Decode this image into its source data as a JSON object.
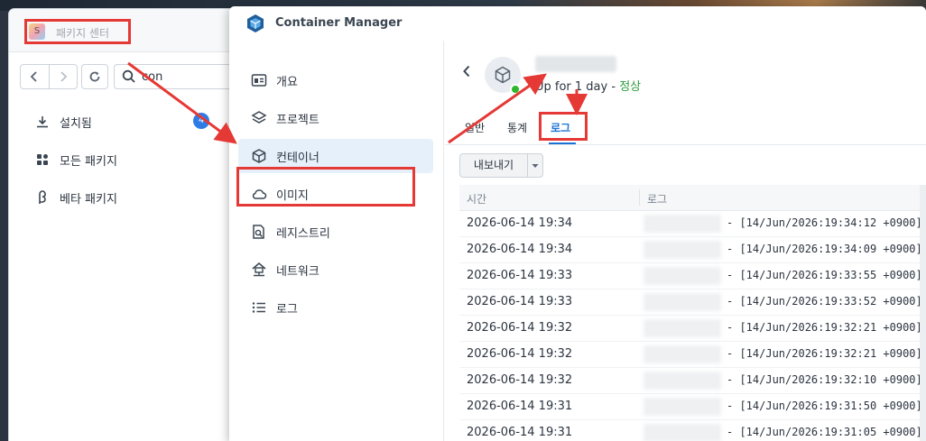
{
  "package_center": {
    "title": "패키지 센터",
    "search": {
      "value": "con",
      "placeholder": ""
    },
    "nav": [
      {
        "label": "설치됨",
        "icon": "download-icon",
        "badge": "4"
      },
      {
        "label": "모든 패키지",
        "icon": "grid-icon"
      },
      {
        "label": "베타 패키지",
        "icon": "beta-icon"
      }
    ]
  },
  "container_manager": {
    "title": "Container Manager",
    "sidebar": [
      {
        "label": "개요",
        "icon": "overview-icon"
      },
      {
        "label": "프로젝트",
        "icon": "layers-icon"
      },
      {
        "label": "컨테이너",
        "icon": "cube-icon",
        "active": true
      },
      {
        "label": "이미지",
        "icon": "cloud-icon"
      },
      {
        "label": "레지스트리",
        "icon": "registry-search-icon"
      },
      {
        "label": "네트워크",
        "icon": "network-icon"
      },
      {
        "label": "로그",
        "icon": "list-icon"
      }
    ],
    "detail": {
      "uptime": "Up for 1 day",
      "separator": " - ",
      "status": "정상",
      "status_color": "#2c9a3e",
      "tabs": [
        "일반",
        "통계",
        "로그"
      ],
      "active_tab": "로그",
      "export_label": "내보내기",
      "table": {
        "columns": [
          "시간",
          "로그"
        ],
        "rows": [
          {
            "time": "2026-06-14 19:34",
            "msg": "- [14/Jun/2026:19:34:12 +0900]"
          },
          {
            "time": "2026-06-14 19:34",
            "msg": "- [14/Jun/2026:19:34:09 +0900]"
          },
          {
            "time": "2026-06-14 19:33",
            "msg": "- [14/Jun/2026:19:33:55 +0900]"
          },
          {
            "time": "2026-06-14 19:33",
            "msg": "- [14/Jun/2026:19:33:52 +0900]"
          },
          {
            "time": "2026-06-14 19:32",
            "msg": "- [14/Jun/2026:19:32:21 +0900]"
          },
          {
            "time": "2026-06-14 19:32",
            "msg": "- [14/Jun/2026:19:32:21 +0900]"
          },
          {
            "time": "2026-06-14 19:32",
            "msg": "- [14/Jun/2026:19:32:10 +0900]"
          },
          {
            "time": "2026-06-14 19:31",
            "msg": "- [14/Jun/2026:19:31:50 +0900]"
          },
          {
            "time": "2026-06-14 19:31",
            "msg": "- [14/Jun/2026:19:31:05 +0900]"
          }
        ]
      }
    }
  },
  "colors": {
    "annotation_red": "#e53935",
    "accent_blue": "#1c73d6",
    "active_bg": "#e6f0fb"
  }
}
